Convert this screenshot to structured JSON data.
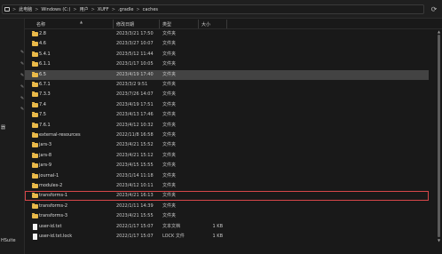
{
  "address": {
    "crumbs": [
      "此电脑",
      "Windows (C:)",
      "用户",
      "XUFF",
      ".gradle",
      "caches"
    ],
    "separator": ">",
    "refresh_icon": "refresh-icon"
  },
  "nav": {
    "pin_icon": "pin-icon",
    "labels": {
      "sm": "器",
      "hsuite": "HSuite"
    }
  },
  "columns": {
    "name": "名称",
    "date": "修改日期",
    "type": "类型",
    "size": "大小"
  },
  "rows": [
    {
      "name": "2.8",
      "date": "2023/3/21 17:50",
      "type": "文件夹",
      "size": "",
      "kind": "folder"
    },
    {
      "name": "4.6",
      "date": "2023/3/27 10:07",
      "type": "文件夹",
      "size": "",
      "kind": "folder"
    },
    {
      "name": "5.4.1",
      "date": "2023/5/12 11:44",
      "type": "文件夹",
      "size": "",
      "kind": "folder"
    },
    {
      "name": "6.1.1",
      "date": "2023/1/17 10:05",
      "type": "文件夹",
      "size": "",
      "kind": "folder"
    },
    {
      "name": "6.5",
      "date": "2023/4/19 17:40",
      "type": "文件夹",
      "size": "",
      "kind": "folder"
    },
    {
      "name": "6.7.1",
      "date": "2023/3/2 9:51",
      "type": "文件夹",
      "size": "",
      "kind": "folder"
    },
    {
      "name": "7.3.3",
      "date": "2023/7/26 14:07",
      "type": "文件夹",
      "size": "",
      "kind": "folder"
    },
    {
      "name": "7.4",
      "date": "2023/4/19 17:51",
      "type": "文件夹",
      "size": "",
      "kind": "folder"
    },
    {
      "name": "7.5",
      "date": "2023/4/13 17:46",
      "type": "文件夹",
      "size": "",
      "kind": "folder"
    },
    {
      "name": "7.6.1",
      "date": "2023/4/12 10:32",
      "type": "文件夹",
      "size": "",
      "kind": "folder"
    },
    {
      "name": "external-resources",
      "date": "2022/11/8 16:58",
      "type": "文件夹",
      "size": "",
      "kind": "folder"
    },
    {
      "name": "jars-3",
      "date": "2023/4/21 15:52",
      "type": "文件夹",
      "size": "",
      "kind": "folder"
    },
    {
      "name": "jars-8",
      "date": "2023/4/21 15:12",
      "type": "文件夹",
      "size": "",
      "kind": "folder"
    },
    {
      "name": "jars-9",
      "date": "2023/4/15 15:55",
      "type": "文件夹",
      "size": "",
      "kind": "folder"
    },
    {
      "name": "journal-1",
      "date": "2023/1/14 11:18",
      "type": "文件夹",
      "size": "",
      "kind": "folder"
    },
    {
      "name": "modules-2",
      "date": "2023/4/12 10:11",
      "type": "文件夹",
      "size": "",
      "kind": "folder"
    },
    {
      "name": "transforms-1",
      "date": "2023/4/21 16:13",
      "type": "文件夹",
      "size": "",
      "kind": "folder"
    },
    {
      "name": "transforms-2",
      "date": "2022/1/11 14:39",
      "type": "文件夹",
      "size": "",
      "kind": "folder"
    },
    {
      "name": "transforms-3",
      "date": "2023/4/21 15:55",
      "type": "文件夹",
      "size": "",
      "kind": "folder"
    },
    {
      "name": "user-id.txt",
      "date": "2022/1/17 15:07",
      "type": "文本文档",
      "size": "1 KB",
      "kind": "file"
    },
    {
      "name": "user-id.txt.lock",
      "date": "2022/1/17 15:07",
      "type": "LOCK 文件",
      "size": "1 KB",
      "kind": "file"
    }
  ],
  "selected_index": 4,
  "highlighted_index": 16,
  "colors": {
    "folder": "#e9b949",
    "selection": "#434343",
    "highlight_outline": "#d8474a",
    "background": "#191919"
  }
}
